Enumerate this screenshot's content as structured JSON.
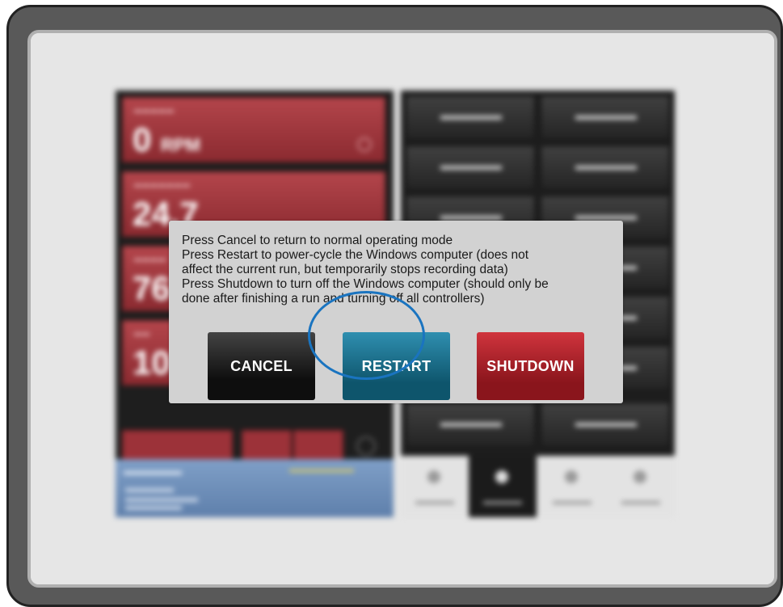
{
  "background_ui": {
    "left_panel": {
      "tiles": [
        {
          "value": "0",
          "unit": "RPM"
        },
        {
          "value": "24.7",
          "unit": ""
        },
        {
          "value": "76",
          "unit": ""
        },
        {
          "value": "10",
          "unit": ""
        }
      ]
    }
  },
  "dialog": {
    "message_lines": [
      "Press Cancel to return to normal operating mode",
      "Press Restart to power-cycle the Windows computer (does not",
      "affect the current run, but temporarily stops recording data)",
      "Press Shutdown to turn off the Windows computer (should only be",
      "done after finishing a run and turning off all controllers)"
    ],
    "buttons": {
      "cancel_label": "CANCEL",
      "restart_label": "RESTART",
      "shutdown_label": "SHUTDOWN"
    }
  },
  "colors": {
    "cancel": "#1a1a1a",
    "restart": "#1a6f8c",
    "shutdown": "#a11c24",
    "highlight_ring": "#1a74c0"
  }
}
